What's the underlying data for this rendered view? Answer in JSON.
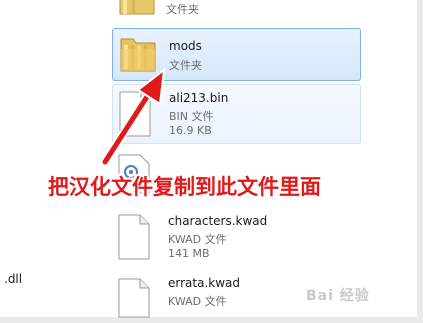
{
  "files": [
    {
      "name": "",
      "type": "文件夹",
      "size": "",
      "icon": "folder-icon",
      "state": "normal"
    },
    {
      "name": "mods",
      "type": "文件夹",
      "size": "",
      "icon": "folder-icon",
      "state": "selected"
    },
    {
      "name": "ali213.bin",
      "type": "BIN 文件",
      "size": "16.9 KB",
      "icon": "document-icon",
      "state": "hover"
    },
    {
      "name": "",
      "type": "",
      "size": "",
      "icon": "settings-file-icon",
      "state": "normal"
    },
    {
      "name": "characters.kwad",
      "type": "KWAD 文件",
      "size": "141 MB",
      "icon": "document-icon",
      "state": "normal"
    },
    {
      "name": "errata.kwad",
      "type": "KWAD 文件",
      "size": "",
      "icon": "document-icon",
      "state": "normal"
    }
  ],
  "left_column": {
    "partial_name": ".dll"
  },
  "annotation": {
    "text": "把汉化文件复制到此文件里面",
    "color": "#e0191b"
  },
  "watermark": {
    "text": "Bai 经验"
  }
}
